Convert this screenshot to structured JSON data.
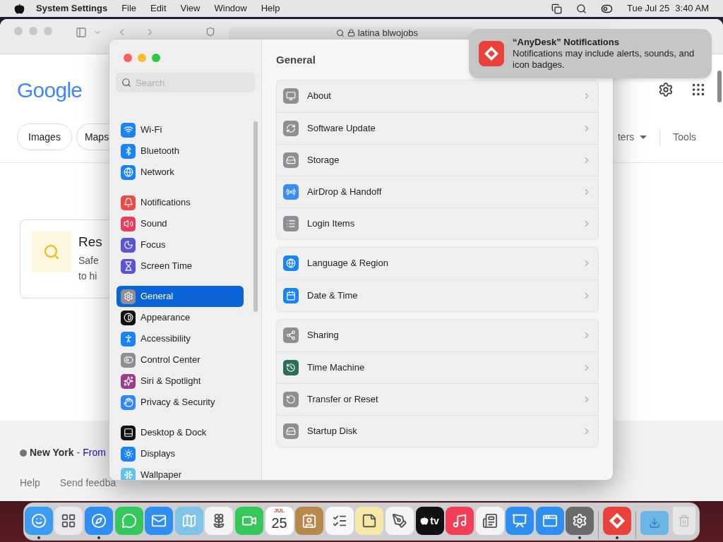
{
  "menu_bar": {
    "app": "System Settings",
    "menus": [
      "File",
      "Edit",
      "View",
      "Window",
      "Help"
    ],
    "date": "Tue Jul 25",
    "time": "3:40 AM"
  },
  "browser": {
    "address": "latina blwojobs",
    "logo": "Google",
    "chips": [
      "Images",
      "Maps"
    ],
    "filters_partial": "ters",
    "tools": "Tools",
    "result": {
      "title": "Res",
      "lines": [
        "Safe",
        "to hi"
      ]
    },
    "location": {
      "place": "New York",
      "separator": "-",
      "link": "From"
    },
    "footer_links": [
      "Help",
      "Send feedba"
    ]
  },
  "settings": {
    "search": {
      "placeholder": "Search"
    },
    "sidebar": {
      "groups": [
        {
          "items": [
            {
              "label": "Wi-Fi",
              "color": "#1a84f5",
              "selected": false
            },
            {
              "label": "Bluetooth",
              "color": "#1a84f5",
              "selected": false
            },
            {
              "label": "Network",
              "color": "#1a84f5",
              "selected": false
            }
          ]
        },
        {
          "items": [
            {
              "label": "Notifications",
              "color": "#ec4b45",
              "selected": false
            },
            {
              "label": "Sound",
              "color": "#ec3b5c",
              "selected": false
            },
            {
              "label": "Focus",
              "color": "#5b55d6",
              "selected": false
            },
            {
              "label": "Screen Time",
              "color": "#5b55d6",
              "selected": false
            }
          ]
        },
        {
          "items": [
            {
              "label": "General",
              "color": "#8e8e93",
              "selected": true
            },
            {
              "label": "Appearance",
              "color": "#111111",
              "selected": false
            },
            {
              "label": "Accessibility",
              "color": "#1a84f5",
              "selected": false
            },
            {
              "label": "Control Center",
              "color": "#8e8e93",
              "selected": false
            },
            {
              "label": "Siri & Spotlight",
              "color": "#9b3d8c",
              "selected": false
            },
            {
              "label": "Privacy & Security",
              "color": "#2f86f6",
              "selected": false
            }
          ]
        },
        {
          "items": [
            {
              "label": "Desktop & Dock",
              "color": "#111111",
              "selected": false
            },
            {
              "label": "Displays",
              "color": "#1a84f5",
              "selected": false
            },
            {
              "label": "Wallpaper",
              "color": "#5ec4e8",
              "selected": false
            }
          ]
        }
      ]
    },
    "title": "General",
    "groups": [
      {
        "rows": [
          {
            "label": "About",
            "color": "#8e8e93"
          },
          {
            "label": "Software Update",
            "color": "#8e8e93"
          },
          {
            "label": "Storage",
            "color": "#8e8e93"
          },
          {
            "label": "AirDrop & Handoff",
            "color": "#3a8ef0"
          },
          {
            "label": "Login Items",
            "color": "#8e8e93"
          }
        ]
      },
      {
        "rows": [
          {
            "label": "Language & Region",
            "color": "#1a84f5"
          },
          {
            "label": "Date & Time",
            "color": "#1a84f5"
          }
        ]
      },
      {
        "rows": [
          {
            "label": "Sharing",
            "color": "#8e8e93"
          },
          {
            "label": "Time Machine",
            "color": "#2b6e5c"
          },
          {
            "label": "Transfer or Reset",
            "color": "#8e8e93"
          },
          {
            "label": "Startup Disk",
            "color": "#8e8e93"
          }
        ]
      }
    ]
  },
  "notification": {
    "title": "“AnyDesk” Notifications",
    "body": "Notifications may include alerts, sounds, and icon badges."
  },
  "dock": {
    "items": [
      {
        "kind": "app",
        "color": "#3d9bf0",
        "running": true
      },
      {
        "kind": "app",
        "color": "#e9e9ee",
        "running": false
      },
      {
        "kind": "app",
        "color": "#2f8ff0",
        "running": true
      },
      {
        "kind": "app",
        "color": "#34c759",
        "running": false
      },
      {
        "kind": "app",
        "color": "#2f8ff0",
        "running": false
      },
      {
        "kind": "app",
        "color": "#7fc3e8",
        "running": false
      },
      {
        "kind": "app",
        "color": "#f4f4f4",
        "running": false
      },
      {
        "kind": "app",
        "color": "#34c759",
        "running": false
      },
      {
        "kind": "calendar",
        "month": "JUL",
        "day": "25",
        "color": "#ffffff",
        "running": false
      },
      {
        "kind": "app",
        "color": "#b8874a",
        "running": false
      },
      {
        "kind": "app",
        "color": "#f7f7f7",
        "running": false
      },
      {
        "kind": "app",
        "color": "#f6e9a8",
        "running": false
      },
      {
        "kind": "app",
        "color": "#f4f4f4",
        "running": false
      },
      {
        "kind": "tv",
        "label": "tv",
        "color": "#111111",
        "running": false
      },
      {
        "kind": "app",
        "color": "#f23e56",
        "running": false
      },
      {
        "kind": "app",
        "color": "#f4f4f4",
        "running": false
      },
      {
        "kind": "app",
        "color": "#2f8ff0",
        "running": false
      },
      {
        "kind": "app",
        "color": "#2f8ff0",
        "running": false
      },
      {
        "kind": "app",
        "color": "#6b6b6b",
        "running": true
      },
      {
        "kind": "separator"
      },
      {
        "kind": "app",
        "color": "#e8423a",
        "running": true
      },
      {
        "kind": "separator"
      },
      {
        "kind": "folder",
        "color": "#6cb6e6",
        "running": false
      },
      {
        "kind": "trash",
        "color": "#e6e6e6",
        "running": false
      }
    ]
  }
}
